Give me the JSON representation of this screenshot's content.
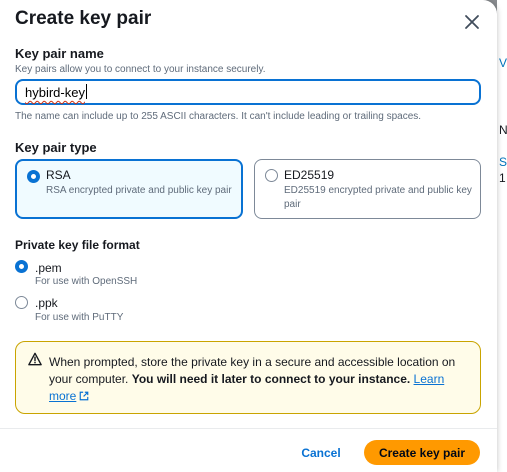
{
  "backdrop": {
    "fragments": [
      "V",
      "Ne",
      "St",
      "1"
    ]
  },
  "dialog": {
    "title": "Create key pair",
    "close_icon": "close-icon"
  },
  "key_name": {
    "label": "Key pair name",
    "description": "Key pairs allow you to connect to your instance securely.",
    "value": "hybird-key",
    "constraint": "The name can include up to 255 ASCII characters. It can't include leading or trailing spaces."
  },
  "key_type": {
    "label": "Key pair type",
    "options": [
      {
        "title": "RSA",
        "description": "RSA encrypted private and public key pair",
        "selected": true
      },
      {
        "title": "ED25519",
        "description": "ED25519 encrypted private and public key pair",
        "selected": false
      }
    ]
  },
  "file_format": {
    "label": "Private key file format",
    "options": [
      {
        "title": ".pem",
        "description": "For use with OpenSSH",
        "selected": true
      },
      {
        "title": ".ppk",
        "description": "For use with PuTTY",
        "selected": false
      }
    ]
  },
  "alert": {
    "icon": "warning-icon",
    "text_plain": "When prompted, store the private key in a secure and accessible location on your computer.",
    "text_bold": "You will need it later to connect to your instance.",
    "link_text": "Learn more",
    "link_icon": "external-link-icon"
  },
  "footer": {
    "cancel_label": "Cancel",
    "create_label": "Create key pair"
  },
  "colors": {
    "accent": "#0972d3",
    "primary_button": "#ff9900",
    "alert_background": "#fffce9",
    "alert_border": "#c9a400"
  }
}
